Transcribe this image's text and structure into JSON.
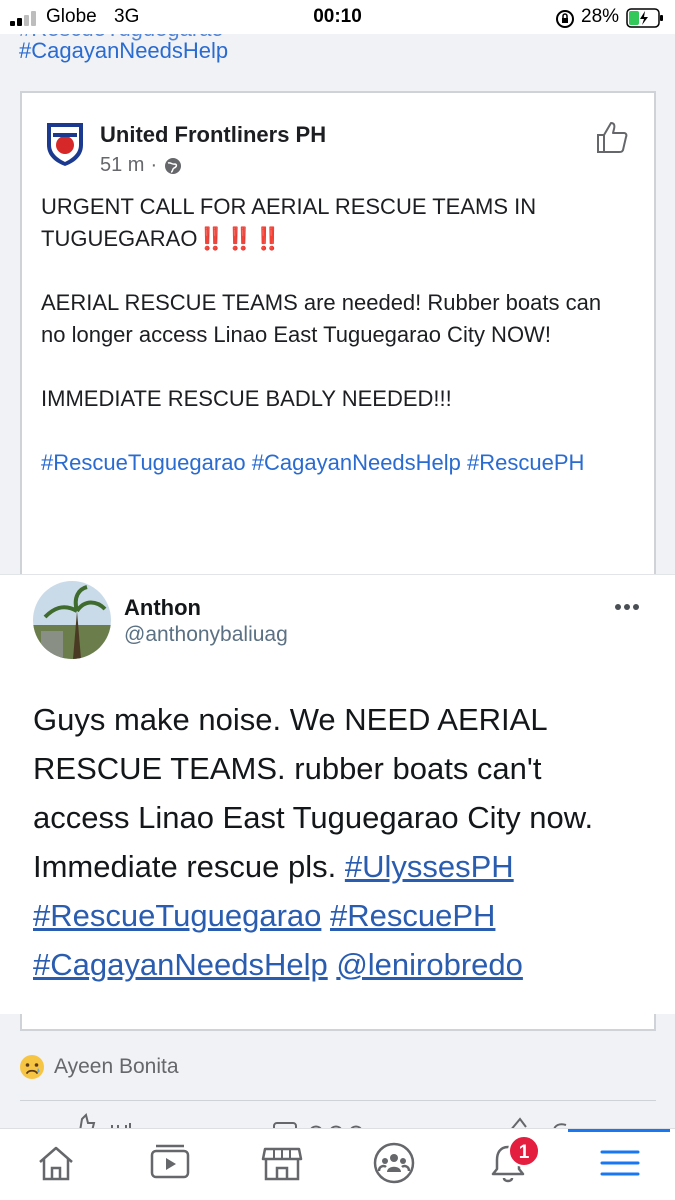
{
  "status_bar": {
    "carrier": "Globe",
    "network": "3G",
    "time": "00:10",
    "battery": "28%"
  },
  "top_tags": {
    "cut_text": "#RescueTuguegarao",
    "tag": "#CagayanNeedsHelp"
  },
  "post": {
    "page_name": "United Frontliners PH",
    "time": "51 m",
    "paragraphs": {
      "p1": "URGENT CALL FOR AERIAL RESCUE TEAMS IN TUGUEGARAO",
      "p1_marks": "‼️‼️‼️",
      "p2": "AERIAL RESCUE TEAMS are needed! Rubber boats can no longer access Linao East Tuguegarao City NOW!",
      "p3": "IMMEDIATE RESCUE BADLY NEEDED!!!",
      "tags": "#RescueTuguegarao #CagayanNeedsHelp #RescuePH"
    }
  },
  "tweet": {
    "name": "Anthon",
    "handle": "@anthonybaliuag",
    "text": "Guys make noise. We NEED AERIAL RESCUE TEAMS. rubber boats can't access Linao East Tuguegarao City now. Immediate rescue pls.",
    "links": [
      "#UlyssesPH",
      "#RescueTuguegarao",
      "#RescuePH",
      "#CagayanNeedsHelp",
      "@lenirobredo"
    ]
  },
  "reactions": {
    "name": "Ayeen Bonita"
  },
  "nav": {
    "notification_count": "1",
    "active_color": "#1877f2",
    "badge_color": "#e41e3f",
    "link_color": "#2a6bd1"
  },
  "icons": [
    "signal-icon",
    "rotation-lock-icon",
    "battery-icon",
    "globe-icon",
    "like-page-icon",
    "more-options-icon",
    "sad-reaction-icon",
    "home-icon",
    "watch-icon",
    "marketplace-icon",
    "groups-icon",
    "notifications-icon",
    "menu-icon"
  ]
}
